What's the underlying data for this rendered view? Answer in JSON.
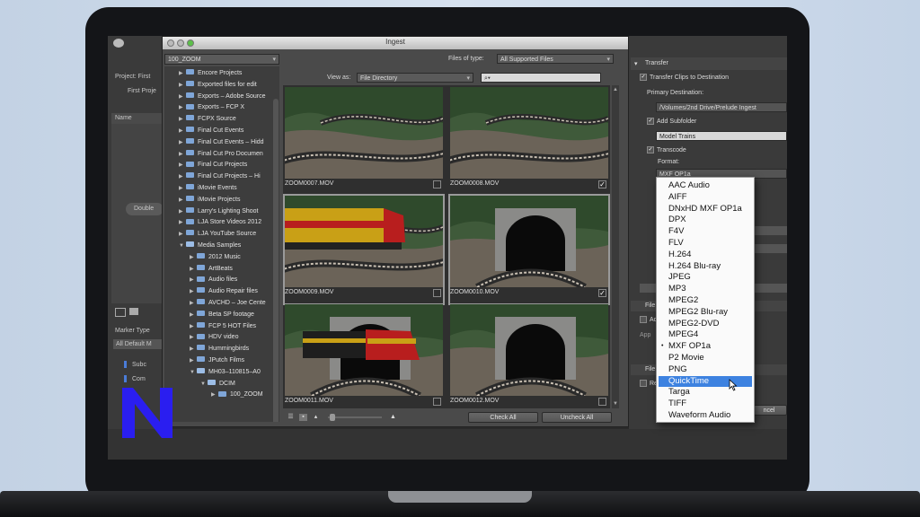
{
  "premiere": {
    "project_label": "Project: First",
    "project_file": "First Proje",
    "name_column": "Name",
    "double_click": "Double",
    "marker_type": "Marker Type",
    "all_default": "All Default M",
    "marker_items": [
      "Subc",
      "Com"
    ]
  },
  "ingest": {
    "title": "Ingest",
    "folder_dropdown": "100_ZOOM",
    "files_of_type_label": "Files of type:",
    "files_of_type_value": "All Supported Files",
    "view_as_label": "View as:",
    "view_as_value": "File Directory",
    "search_placeholder": "",
    "search_icon": "magnifier-icon",
    "folders": [
      {
        "label": "Encore Projects",
        "level": 0,
        "open": false
      },
      {
        "label": "Exported files for edit",
        "level": 0,
        "open": false
      },
      {
        "label": "Exports – Adobe Source",
        "level": 0,
        "open": false
      },
      {
        "label": "Exports – FCP X",
        "level": 0,
        "open": false
      },
      {
        "label": "FCPX Source",
        "level": 0,
        "open": false
      },
      {
        "label": "Final Cut Events",
        "level": 0,
        "open": false
      },
      {
        "label": "Final Cut Events – Hidd",
        "level": 0,
        "open": false
      },
      {
        "label": "Final Cut Pro Documen",
        "level": 0,
        "open": false
      },
      {
        "label": "Final Cut Projects",
        "level": 0,
        "open": false
      },
      {
        "label": "Final Cut Projects – Hi",
        "level": 0,
        "open": false
      },
      {
        "label": "iMovie Events",
        "level": 0,
        "open": false
      },
      {
        "label": "iMovie Projects",
        "level": 0,
        "open": false
      },
      {
        "label": "Larry's Lighting Shoot",
        "level": 0,
        "open": false
      },
      {
        "label": "LJA Store Videos 2012",
        "level": 0,
        "open": false
      },
      {
        "label": "LJA YouTube Source",
        "level": 0,
        "open": false
      },
      {
        "label": "Media Samples",
        "level": 0,
        "open": true
      },
      {
        "label": "2012 Music",
        "level": 1,
        "open": false
      },
      {
        "label": "ArtBeats",
        "level": 1,
        "open": false
      },
      {
        "label": "Audio files",
        "level": 1,
        "open": false
      },
      {
        "label": "Audio Repair files",
        "level": 1,
        "open": false
      },
      {
        "label": "AVCHD – Joe Cente",
        "level": 1,
        "open": false
      },
      {
        "label": "Beta SP footage",
        "level": 1,
        "open": false
      },
      {
        "label": "FCP 5 HOT Files",
        "level": 1,
        "open": false
      },
      {
        "label": "HDV video",
        "level": 1,
        "open": false
      },
      {
        "label": "Hummingbirds",
        "level": 1,
        "open": false
      },
      {
        "label": "JPutch Films",
        "level": 1,
        "open": false
      },
      {
        "label": "MH03–110815–A0",
        "level": 1,
        "open": true
      },
      {
        "label": "DCIM",
        "level": 2,
        "open": true
      },
      {
        "label": "100_ZOOM",
        "level": 3,
        "open": false
      }
    ],
    "clips": [
      {
        "name": "ZOOM0007.MOV",
        "checked": false,
        "selected": false,
        "scene": "track"
      },
      {
        "name": "ZOOM0008.MOV",
        "checked": true,
        "selected": false,
        "scene": "track"
      },
      {
        "name": "ZOOM0009.MOV",
        "checked": false,
        "selected": true,
        "scene": "train"
      },
      {
        "name": "ZOOM0010.MOV",
        "checked": true,
        "selected": true,
        "scene": "tunnel"
      },
      {
        "name": "ZOOM0011.MOV",
        "checked": false,
        "selected": false,
        "scene": "tunnel-train"
      },
      {
        "name": "ZOOM0012.MOV",
        "checked": false,
        "selected": false,
        "scene": "tunnel"
      }
    ],
    "check_all": "Check All",
    "uncheck_all": "Uncheck All"
  },
  "transfer": {
    "header": "Transfer",
    "transfer_clips": "Transfer Clips to Destination",
    "primary_destination_label": "Primary Destination:",
    "primary_destination_value": "/Volumes/2nd Drive/Prelude Ingest",
    "add_subfolder": "Add Subfolder",
    "subfolder_value": "Model Trains",
    "transcode": "Transcode",
    "format_label": "Format:",
    "format_value": "MXF OP1a",
    "section_stubs": [
      "File",
      "Ad",
      "App",
      "File",
      "Re"
    ],
    "cancel": "ncel"
  },
  "format_menu": {
    "items": [
      "AAC Audio",
      "AIFF",
      "DNxHD MXF OP1a",
      "DPX",
      "F4V",
      "FLV",
      "H.264",
      "H.264 Blu-ray",
      "JPEG",
      "MP3",
      "MPEG2",
      "MPEG2 Blu-ray",
      "MPEG2-DVD",
      "MPEG4",
      "MXF OP1a",
      "P2 Movie",
      "PNG",
      "QuickTime",
      "Targa",
      "TIFF",
      "Waveform Audio"
    ],
    "current": "MXF OP1a",
    "highlighted": "QuickTime"
  },
  "colors": {
    "highlight": "#3d82e0",
    "logo": "#2a1ef0",
    "folder": "#7fa6d8"
  }
}
